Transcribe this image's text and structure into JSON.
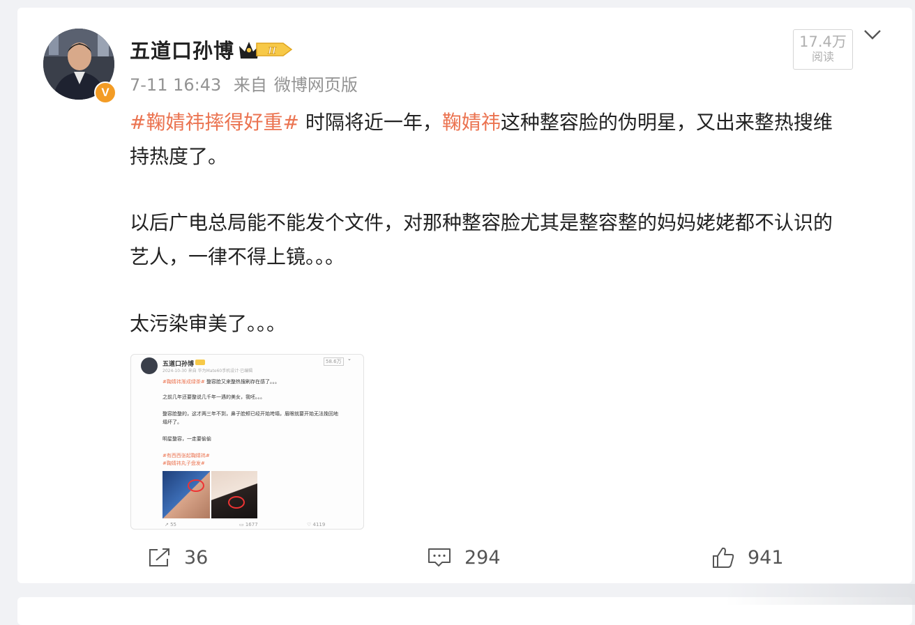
{
  "post": {
    "author": "五道口孙博",
    "verified_badge": "V",
    "level_badge": "II",
    "time": "7-11 16:43",
    "source_prefix": "来自",
    "source": "微博网页版",
    "reads": {
      "count": "17.4万",
      "label": "阅读"
    },
    "paragraphs": [
      {
        "line1": {
          "tag": "#鞠婧祎摔得好重#",
          "t1": " 时隔将近一年，",
          "mention": "鞠婧祎",
          "t2": "这种整容脸的伪明星，又出来整热搜维"
        },
        "line2": "持热度了。"
      },
      {
        "line1": "以后广电总局能不能发个文件，对那种整容脸尤其是整容整的妈妈姥姥都不认识的",
        "line2": "艺人，一律不得上镜。。。"
      },
      {
        "line1": "太污染审美了。。。"
      }
    ],
    "actions": {
      "repost": "36",
      "comment": "294",
      "like": "941"
    }
  },
  "thumbnail": {
    "author": "五道口孙博",
    "reads": "58.6万",
    "meta": "2024-10-30 来自 华为Mate60手机设计·已编辑",
    "tag1": "#鞠婧祎渐成绿茶#",
    "l1": "整容脸又来整热搜刷存在感了。。。",
    "l2": "之前几年还要整说几千年一遇的美女，我呸。。。",
    "l3": "整容脸整的，这才两三年不到，鼻子脸颊已经开始垮塌，眉眼就要开始无法挽回地",
    "l3b": "塌坏了。",
    "l4": "明星整容，一走要偷偷",
    "tag2": "#有西西张起鞠婧祎#",
    "tag3": "#鞠婧祎丸子盘发#",
    "repost": "55",
    "comment": "1677",
    "like": "4119"
  },
  "colors": {
    "accent": "#eb7350",
    "badge": "#f39c25",
    "muted": "#939393"
  }
}
